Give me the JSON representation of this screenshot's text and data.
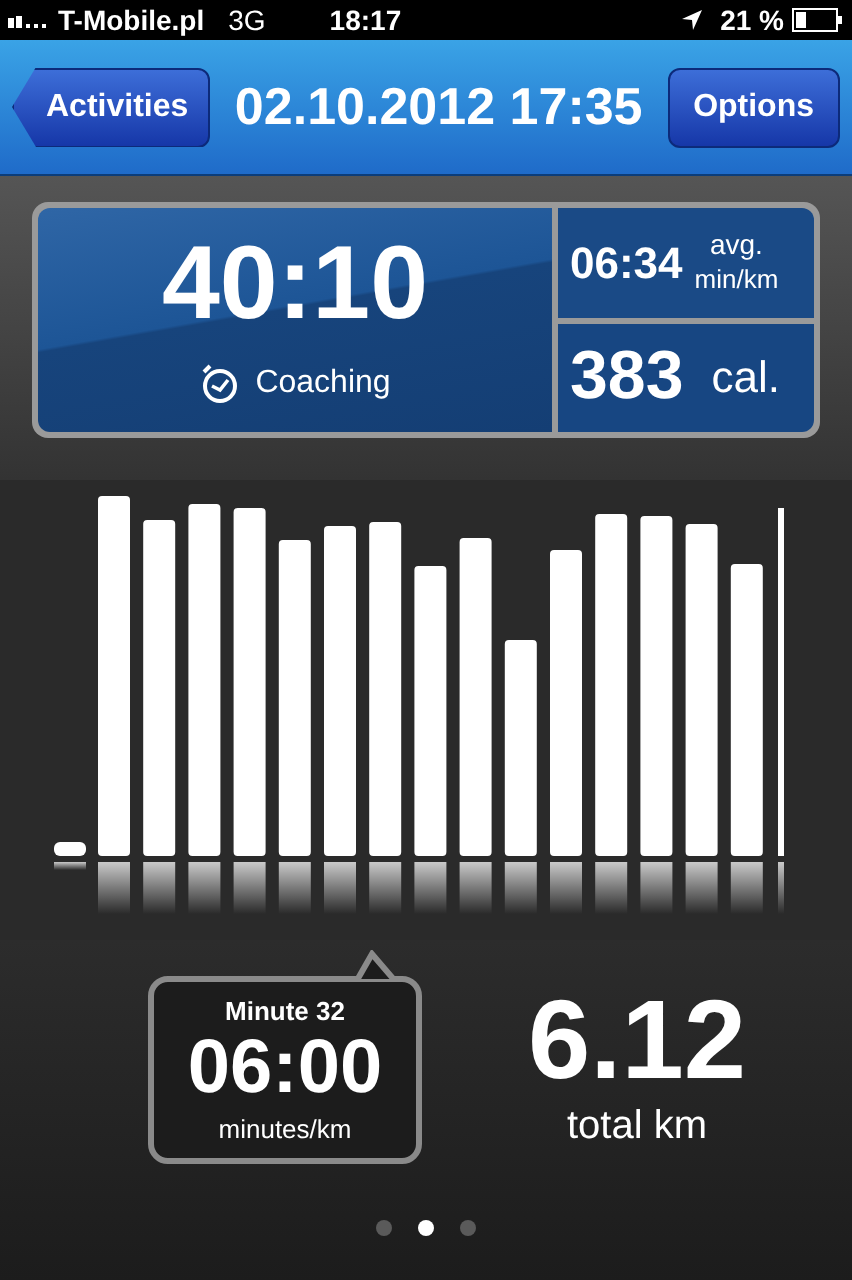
{
  "status_bar": {
    "carrier": "T-Mobile.pl",
    "network": "3G",
    "time": "18:17",
    "battery": "21 %"
  },
  "nav_bar": {
    "back_button": "Activities",
    "title": "02.10.2012 17:35",
    "right_button": "Options"
  },
  "summary": {
    "duration": "40:10",
    "mode": "Coaching",
    "pace": "06:34",
    "pace_unit_top": "avg.",
    "pace_unit_bottom": "min/km",
    "calories": "383",
    "calories_unit": "cal."
  },
  "callout": {
    "title": "Minute 32",
    "value": "06:00",
    "unit": "minutes/km"
  },
  "distance": {
    "value": "6.12",
    "unit": "total km"
  },
  "pages": [
    {
      "selected": false
    },
    {
      "selected": true
    },
    {
      "selected": false
    }
  ]
}
